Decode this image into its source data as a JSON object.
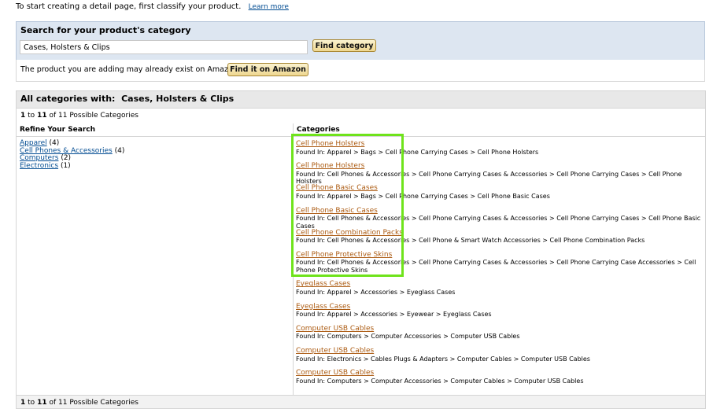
{
  "intro": {
    "text": "To start creating a detail page, first classify your product.",
    "learn_more": "Learn more"
  },
  "search": {
    "title": "Search for your product's category",
    "value": "Cases, Holsters & Clips",
    "button": "Find category"
  },
  "exist": {
    "text": "The product you are adding may already exist on Amazon:",
    "button": "Find it on Amazon"
  },
  "results": {
    "heading_prefix": "All categories with:",
    "heading_term": "Cases, Holsters & Clips",
    "count_start": "1",
    "count_to": "to",
    "count_end": "11",
    "count_of": "of 11 Possible Categories",
    "refine_heading": "Refine Your Search",
    "categories_heading": "Categories",
    "refine": [
      {
        "label": "Apparel",
        "count": "(4)"
      },
      {
        "label": "Cell Phones & Accessories",
        "count": "(4)"
      },
      {
        "label": "Computers",
        "count": "(2)"
      },
      {
        "label": "Electronics",
        "count": "(1)"
      }
    ],
    "categories": [
      {
        "name": "Cell Phone Holsters",
        "path": "Found In: Apparel > Bags > Cell Phone Carrying Cases > Cell Phone Holsters"
      },
      {
        "name": "Cell Phone Holsters",
        "path": "Found In: Cell Phones & Accessories > Cell Phone Carrying Cases & Accessories > Cell Phone Carrying Cases > Cell Phone Holsters"
      },
      {
        "name": "Cell Phone Basic Cases",
        "path": "Found In: Apparel > Bags > Cell Phone Carrying Cases > Cell Phone Basic Cases"
      },
      {
        "name": "Cell Phone Basic Cases",
        "path": "Found In: Cell Phones & Accessories > Cell Phone Carrying Cases & Accessories > Cell Phone Carrying Cases > Cell Phone Basic Cases"
      },
      {
        "name": "Cell Phone Combination Packs",
        "path": "Found In: Cell Phones & Accessories > Cell Phone & Smart Watch Accessories > Cell Phone Combination Packs"
      },
      {
        "name": "Cell Phone Protective Skins",
        "path": "Found In: Cell Phones & Accessories > Cell Phone Carrying Cases & Accessories > Cell Phone Carrying Case Accessories > Cell Phone Protective Skins"
      },
      {
        "name": "Eyeglass Cases",
        "path": "Found In: Apparel > Accessories > Eyeglass Cases"
      },
      {
        "name": "Eyeglass Cases",
        "path": "Found In: Apparel > Accessories > Eyewear > Eyeglass Cases"
      },
      {
        "name": "Computer USB Cables",
        "path": "Found In: Computers > Computer Accessories > Computer USB Cables"
      },
      {
        "name": "Computer USB Cables",
        "path": "Found In: Electronics > Cables Plugs & Adapters > Computer Cables > Computer USB Cables"
      },
      {
        "name": "Computer USB Cables",
        "path": "Found In: Computers > Computer Accessories > Computer Cables > Computer USB Cables"
      }
    ]
  },
  "colors": {
    "link_blue": "#004b91",
    "link_brown": "#ac5b12",
    "highlight": "#6fe31b",
    "search_bg": "#dde6f1"
  }
}
